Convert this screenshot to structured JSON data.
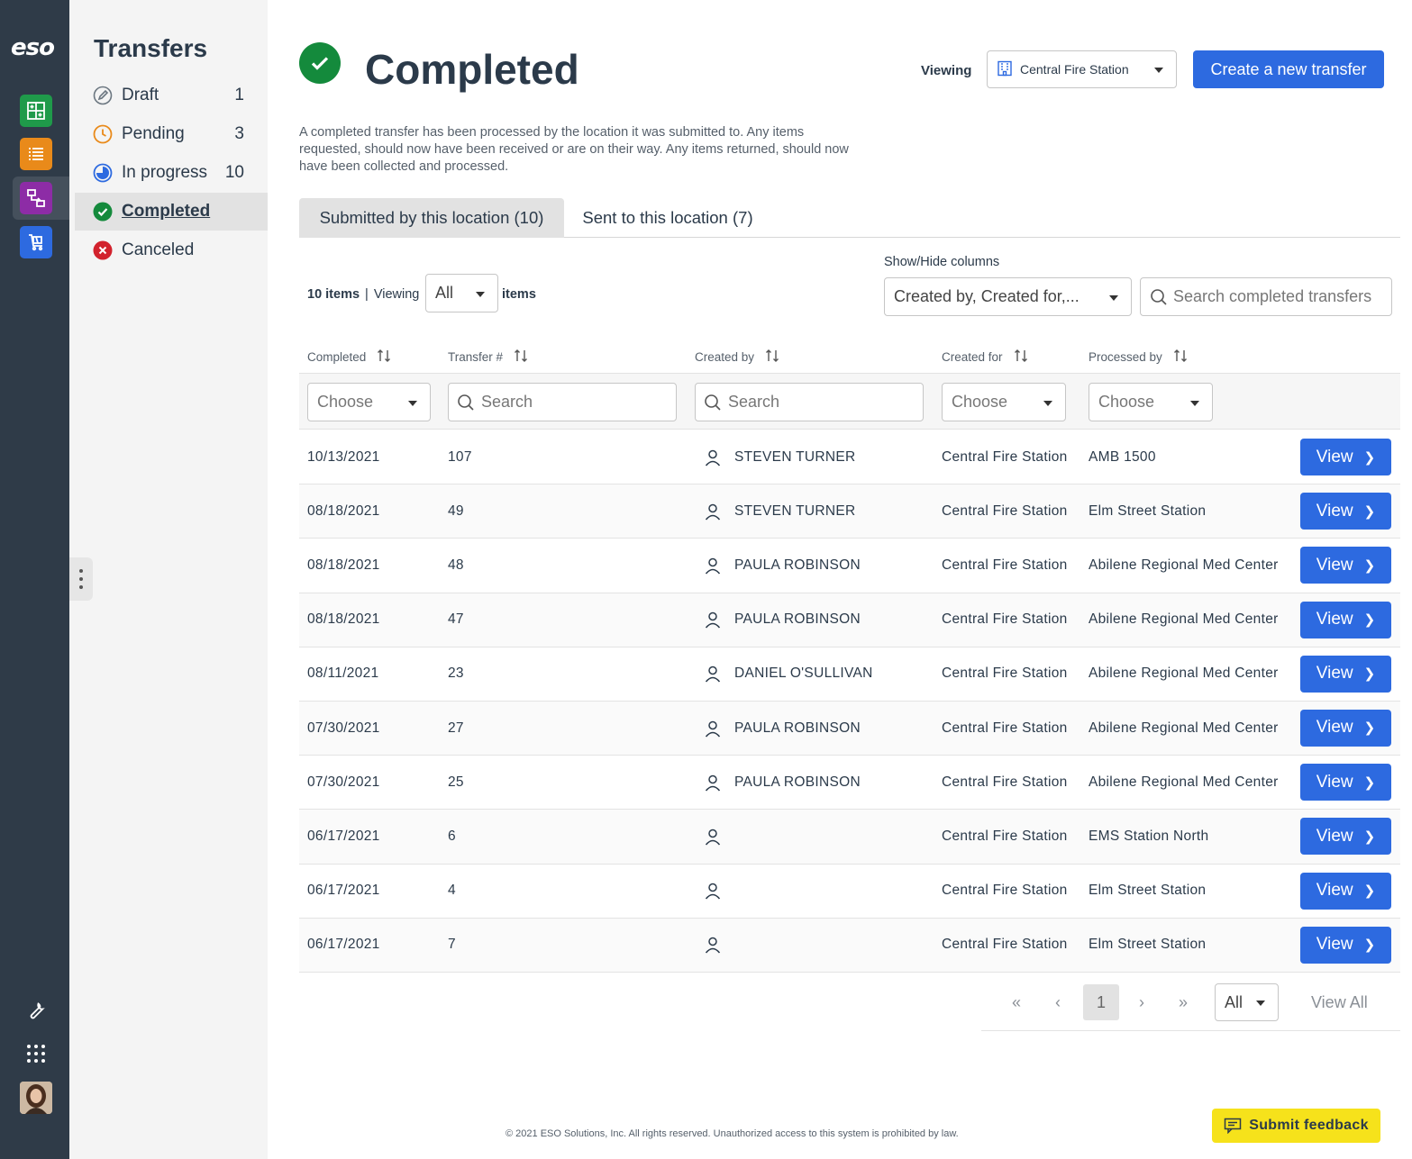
{
  "rail": {
    "logo": "eso",
    "apps": [
      {
        "name": "inventory-app-icon",
        "color": "#1f9a4a"
      },
      {
        "name": "list-app-icon",
        "color": "#e98a1a"
      },
      {
        "name": "transfers-app-icon",
        "color": "#8d2ca6"
      },
      {
        "name": "cart-app-icon",
        "color": "#2d6ae0"
      }
    ]
  },
  "subnav": {
    "title": "Transfers",
    "items": [
      {
        "label": "Draft",
        "count": "1",
        "icon": "pencil-icon"
      },
      {
        "label": "Pending",
        "count": "3",
        "icon": "clock-icon"
      },
      {
        "label": "In progress",
        "count": "10",
        "icon": "pie-progress-icon"
      },
      {
        "label": "Completed",
        "count": "",
        "icon": "check-circle-icon"
      },
      {
        "label": "Canceled",
        "count": "",
        "icon": "x-circle-icon"
      }
    ]
  },
  "header": {
    "title": "Completed",
    "viewing_label": "Viewing",
    "location": "Central Fire Station",
    "create_button": "Create a new transfer",
    "description": "A completed transfer has been processed by the location it was submitted to. Any items requested, should now have been received or are on their way. Any items returned, should now have been collected and processed."
  },
  "tabs": [
    {
      "label": "Submitted by this location (10)",
      "active": true
    },
    {
      "label": "Sent to this location (7)",
      "active": false
    }
  ],
  "toolbar": {
    "items_count": "10 items",
    "separator": "|",
    "viewing": "Viewing",
    "page_size": "All",
    "items_suffix": "items",
    "showhide_label": "Show/Hide columns",
    "showhide_value": "Created by, Created for,...",
    "search_placeholder": "Search completed transfers"
  },
  "columns": {
    "completed": "Completed",
    "transfer": "Transfer #",
    "created_by": "Created by",
    "created_for": "Created for",
    "processed_by": "Processed by"
  },
  "filters": {
    "completed": "Choose",
    "transfer": "Search",
    "created_by": "Search",
    "created_for": "Choose",
    "processed_by": "Choose"
  },
  "rows": [
    {
      "completed": "10/13/2021",
      "transfer": "107",
      "created_by": "STEVEN TURNER",
      "created_for": "Central Fire Station",
      "processed_by": "AMB 1500",
      "action": "View"
    },
    {
      "completed": "08/18/2021",
      "transfer": "49",
      "created_by": "STEVEN TURNER",
      "created_for": "Central Fire Station",
      "processed_by": "Elm Street Station",
      "action": "View"
    },
    {
      "completed": "08/18/2021",
      "transfer": "48",
      "created_by": "PAULA ROBINSON",
      "created_for": "Central Fire Station",
      "processed_by": "Abilene Regional Med Center",
      "action": "View"
    },
    {
      "completed": "08/18/2021",
      "transfer": "47",
      "created_by": "PAULA ROBINSON",
      "created_for": "Central Fire Station",
      "processed_by": "Abilene Regional Med Center",
      "action": "View"
    },
    {
      "completed": "08/11/2021",
      "transfer": "23",
      "created_by": "DANIEL O'SULLIVAN",
      "created_for": "Central Fire Station",
      "processed_by": "Abilene Regional Med Center",
      "action": "View"
    },
    {
      "completed": "07/30/2021",
      "transfer": "27",
      "created_by": "PAULA ROBINSON",
      "created_for": "Central Fire Station",
      "processed_by": "Abilene Regional Med Center",
      "action": "View"
    },
    {
      "completed": "07/30/2021",
      "transfer": "25",
      "created_by": "PAULA ROBINSON",
      "created_for": "Central Fire Station",
      "processed_by": "Abilene Regional Med Center",
      "action": "View"
    },
    {
      "completed": "06/17/2021",
      "transfer": "6",
      "created_by": "",
      "created_for": "Central Fire Station",
      "processed_by": "EMS Station North",
      "action": "View"
    },
    {
      "completed": "06/17/2021",
      "transfer": "4",
      "created_by": "",
      "created_for": "Central Fire Station",
      "processed_by": "Elm Street Station",
      "action": "View"
    },
    {
      "completed": "06/17/2021",
      "transfer": "7",
      "created_by": "",
      "created_for": "Central Fire Station",
      "processed_by": "Elm Street Station",
      "action": "View"
    }
  ],
  "pager": {
    "first": "«",
    "prev": "‹",
    "current": "1",
    "next": "›",
    "last": "»",
    "size": "All",
    "view_all": "View All"
  },
  "footer": "© 2021 ESO Solutions, Inc. All rights reserved. Unauthorized access to this system is prohibited by law.",
  "feedback": "Submit feedback"
}
